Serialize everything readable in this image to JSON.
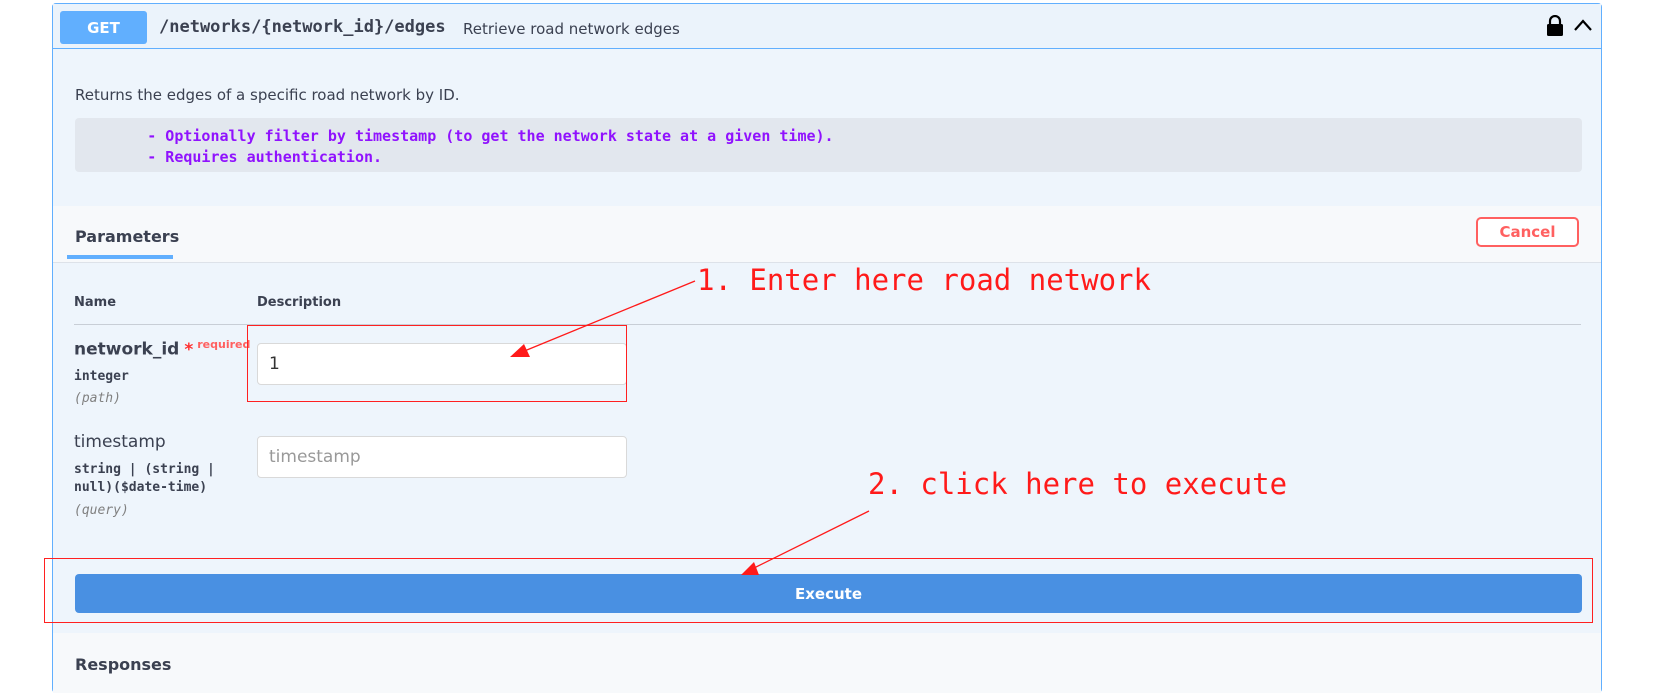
{
  "endpoint": {
    "method": "GET",
    "path": "/networks/{network_id}/edges",
    "summary": "Retrieve road network edges",
    "description": "Returns the edges of a specific road network by ID.",
    "notes": "        - Optionally filter by timestamp (to get the network state at a given time).\n        - Requires authentication."
  },
  "tabs": {
    "parameters": "Parameters",
    "cancel": "Cancel"
  },
  "columns": {
    "name": "Name",
    "description": "Description"
  },
  "params": [
    {
      "name": "network_id",
      "required_star": "*",
      "required_label": "required",
      "type": "integer",
      "in": "(path)",
      "value": "1",
      "placeholder": ""
    },
    {
      "name": "timestamp",
      "type_line1": "string | (string |",
      "type_line2": "null)($date-time)",
      "in": "(query)",
      "value": "",
      "placeholder": "timestamp"
    }
  ],
  "execute_label": "Execute",
  "responses_label": "Responses",
  "annotations": {
    "step1": "1. Enter here road network",
    "step2": "2. click here to execute",
    "color": "#ff1a1a"
  },
  "colors": {
    "method_get": "#61affe",
    "execute": "#4990e2",
    "cancel": "#ff6060",
    "notes_text": "#9012fe"
  },
  "icons": [
    "lock-icon",
    "chevron-up-icon"
  ]
}
